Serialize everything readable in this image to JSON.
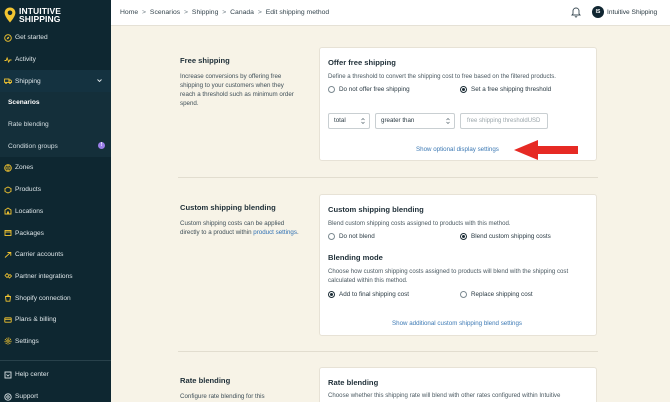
{
  "app": {
    "logo_line1": "INTUITIVE",
    "logo_line2": "SHIPPING"
  },
  "sidebar": {
    "items": [
      {
        "label": "Get started",
        "icon": "compass-icon"
      },
      {
        "label": "Activity",
        "icon": "activity-icon"
      },
      {
        "label": "Shipping",
        "icon": "shipping-icon"
      },
      {
        "label": "Scenarios"
      },
      {
        "label": "Rate blending"
      },
      {
        "label": "Condition groups",
        "badge": "!"
      },
      {
        "label": "Zones",
        "icon": "zones-icon"
      },
      {
        "label": "Products",
        "icon": "products-icon"
      },
      {
        "label": "Locations",
        "icon": "locations-icon"
      },
      {
        "label": "Packages",
        "icon": "packages-icon"
      },
      {
        "label": "Carrier accounts",
        "icon": "carrier-icon"
      },
      {
        "label": "Partner integrations",
        "icon": "partner-icon"
      },
      {
        "label": "Shopify connection",
        "icon": "shopify-icon"
      },
      {
        "label": "Plans & billing",
        "icon": "billing-icon"
      },
      {
        "label": "Settings",
        "icon": "gear-icon"
      }
    ],
    "bottom": [
      {
        "label": "Help center",
        "icon": "help-icon"
      },
      {
        "label": "Support",
        "icon": "support-icon"
      }
    ]
  },
  "topbar": {
    "breadcrumb": [
      "Home",
      "Scenarios",
      "Shipping",
      "Canada",
      "Edit shipping method"
    ],
    "separator": ">",
    "avatar_initials": "IS",
    "user_name": "Intuitive Shipping"
  },
  "colors": {
    "sidebar_bg": "#0e2731",
    "content_bg": "#f7f3e7",
    "logo_yellow": "#f3c531",
    "annotation_red": "#e62a24"
  },
  "free_shipping": {
    "section_title": "Free shipping",
    "section_desc": "Increase conversions by offering free shipping to your customers when they reach a threshold such as minimum order spend.",
    "card_title": "Offer free shipping",
    "card_desc": "Define a threshold to convert the shipping cost to free based on the filtered products.",
    "option_none": "Do not offer free shipping",
    "option_threshold": "Set a free shipping threshold",
    "selected": "threshold",
    "select_field": "total",
    "select_operator": "greater than",
    "threshold_placeholder": "free shipping threshold",
    "currency": "USD",
    "optional_link": "Show optional display settings"
  },
  "custom_blending": {
    "section_title": "Custom shipping blending",
    "section_desc_pre": "Custom shipping costs can be applied directly to a product within ",
    "section_desc_link": "product settings",
    "section_desc_post": ".",
    "card_title": "Custom shipping blending",
    "card_desc": "Blend custom shipping costs assigned to products with this method.",
    "option_no_blend": "Do not blend",
    "option_blend": "Blend custom shipping costs",
    "selected": "blend",
    "mode_title": "Blending mode",
    "mode_desc": "Choose how custom shipping costs assigned to products will blend with the shipping cost calculated within this method.",
    "mode_add": "Add to final shipping cost",
    "mode_replace": "Replace shipping cost",
    "mode_selected": "add",
    "additional_link": "Show additional custom shipping blend settings"
  },
  "rate_blending": {
    "section_title": "Rate blending",
    "section_desc": "Configure rate blending for this",
    "card_title": "Rate blending",
    "card_desc": "Choose whether this shipping rate will blend with other rates configured within Intuitive"
  }
}
